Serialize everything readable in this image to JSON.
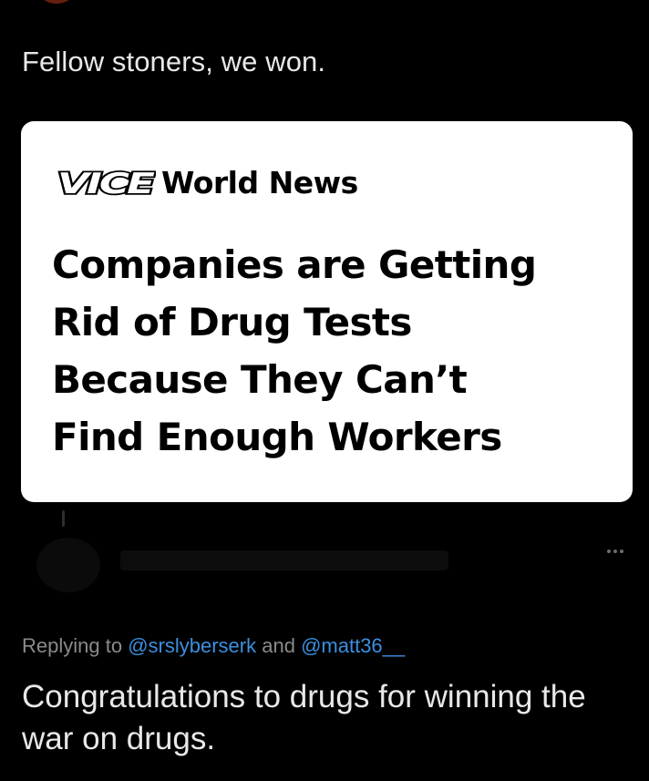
{
  "tweet": {
    "text": "Fellow stoners, we won."
  },
  "card": {
    "brand_logo": "VICE",
    "brand_section": "World News",
    "headline_lines": [
      "Companies are Getting",
      "Rid of Drug Tests",
      "Because They Can’t",
      "Find Enough Workers"
    ]
  },
  "reply": {
    "replying_to_label": "Replying to",
    "mention_1": "@srslyberserk",
    "conjunction": "and",
    "mention_2": "@matt36__",
    "text": "Congratulations to drugs for winning the war on drugs."
  },
  "icons": {
    "more": "more-horizontal-icon",
    "logo": "vice-logo-icon"
  },
  "colors": {
    "background": "#000000",
    "card": "#ffffff",
    "mention": "#3b8fe0",
    "muted": "#8a8a8a"
  }
}
